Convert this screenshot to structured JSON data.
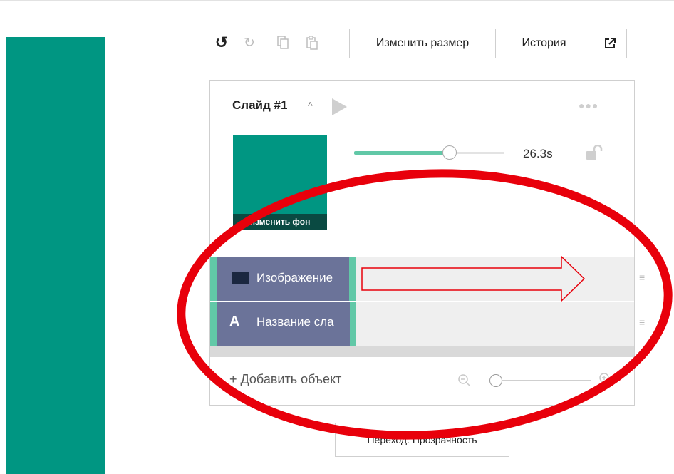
{
  "toolbar": {
    "resize_label": "Изменить размер",
    "history_label": "История",
    "icons": [
      "undo-icon",
      "redo-icon",
      "copy-icon",
      "paste-icon",
      "external-link-icon"
    ]
  },
  "slide": {
    "title": "Слайд #1",
    "background_label": "изменить фон",
    "duration": "26.3s",
    "duration_progress": 0.63
  },
  "timeline": {
    "rows": [
      {
        "label": "Изображение",
        "icon": "image-icon"
      },
      {
        "label": "Название сла",
        "icon": "text-icon",
        "icon_text": "A"
      }
    ]
  },
  "footer": {
    "add_object_label": "Добавить объект",
    "add_icon": "+",
    "zoom_level": 0.05
  },
  "transition_label": "Переход: Прозрачность",
  "colors": {
    "accent": "#009682",
    "track_fill": "#61c8a7",
    "bar": "#6b7399",
    "annotation": "#e8000b"
  }
}
